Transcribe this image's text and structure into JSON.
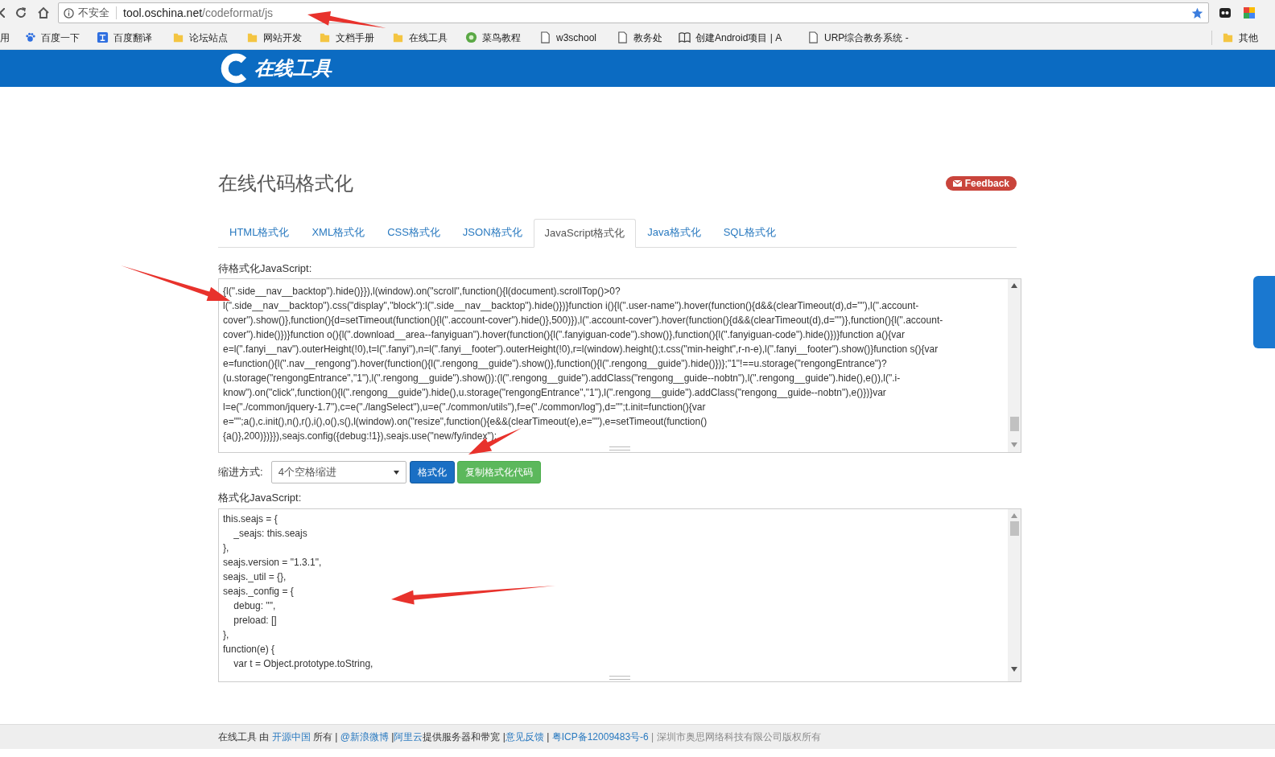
{
  "browser": {
    "security": "不安全",
    "url_host": "tool.oschina.net",
    "url_path": "/codeformat/js",
    "bookmarks": [
      {
        "label": "用",
        "kind": "none"
      },
      {
        "label": "百度一下",
        "kind": "paw"
      },
      {
        "label": "百度翻译",
        "kind": "translate"
      },
      {
        "label": "论坛站点",
        "kind": "folder"
      },
      {
        "label": "网站开发",
        "kind": "folder"
      },
      {
        "label": "文档手册",
        "kind": "folder"
      },
      {
        "label": "在线工具",
        "kind": "folder"
      },
      {
        "label": "菜鸟教程",
        "kind": "circle"
      },
      {
        "label": "w3school",
        "kind": "page"
      },
      {
        "label": "教务处",
        "kind": "page"
      },
      {
        "label": "创建Android项目 | A",
        "kind": "book"
      },
      {
        "label": "URP综合教务系统 - ",
        "kind": "page"
      }
    ],
    "other_bookmarks": "其他"
  },
  "header": {
    "logo_text": "在线工具"
  },
  "title": "在线代码格式化",
  "feedback": "Feedback",
  "tabs": [
    {
      "label": "HTML格式化",
      "selected": false
    },
    {
      "label": "XML格式化",
      "selected": false
    },
    {
      "label": "CSS格式化",
      "selected": false
    },
    {
      "label": "JSON格式化",
      "selected": false
    },
    {
      "label": "JavaScript格式化",
      "selected": true
    },
    {
      "label": "Java格式化",
      "selected": false
    },
    {
      "label": "SQL格式化",
      "selected": false
    }
  ],
  "input_label": "待格式化JavaScript:",
  "input_lines": [
    "{l(\".side__nav__backtop\").hide()}}),l(window).on(\"scroll\",function(){l(document).scrollTop()>0?",
    "l(\".side__nav__backtop\").css(\"display\",\"block\"):l(\".side__nav__backtop\").hide()})}function i(){l(\".user-name\").hover(function(){d&&(clearTimeout(d),d=\"\"),l(\".account-",
    "cover\").show()},function(){d=setTimeout(function(){l(\".account-cover\").hide()},500)}),l(\".account-cover\").hover(function(){d&&(clearTimeout(d),d=\"\")},function(){l(\".account-",
    "cover\").hide()})}function o(){l(\".download__area--fanyiguan\").hover(function(){l(\".fanyiguan-code\").show()},function(){l(\".fanyiguan-code\").hide()})}function a(){var",
    "e=l(\".fanyi__nav\").outerHeight(!0),t=l(\".fanyi\"),n=l(\".fanyi__footer\").outerHeight(!0),r=l(window).height();t.css(\"min-height\",r-n-e),l(\".fanyi__footer\").show()}function s(){var",
    "e=function(){l(\".nav__rengong\").hover(function(){l(\".rengong__guide\").show()},function(){l(\".rengong__guide\").hide()})};\"1\"!==u.storage(\"rengongEntrance\")?",
    "(u.storage(\"rengongEntrance\",\"1\"),l(\".rengong__guide\").show()):(l(\".rengong__guide\").addClass(\"rengong__guide--nobtn\"),l(\".rengong__guide\").hide(),e()),l(\".i-",
    "know\").on(\"click\",function(){l(\".rengong__guide\").hide(),u.storage(\"rengongEntrance\",\"1\"),l(\".rengong__guide\").addClass(\"rengong__guide--nobtn\"),e()})}var",
    "l=e(\"./common/jquery-1.7\"),c=e(\"./langSelect\"),u=e(\"./common/utils\"),f=e(\"./common/log\"),d=\"\";t.init=function(){var",
    "e=\"\";a(),c.init(),n(),r(),i(),o(),s(),l(window).on(\"resize\",function(){e&&(clearTimeout(e),e=\"\"),e=setTimeout(function()",
    "{a()},200)})}}),seajs.config({debug:!1}),seajs.use(\"new/fy/index\");"
  ],
  "indent_label": "缩进方式:",
  "indent_value": "4个空格缩进",
  "buttons": [
    {
      "label": "格式化",
      "kind": "primary"
    },
    {
      "label": "复制格式化代码",
      "kind": "success"
    }
  ],
  "output_label": "格式化JavaScript:",
  "output_lines": [
    "this.seajs = {",
    "    _seajs: this.seajs",
    "},",
    "seajs.version = \"1.3.1\",",
    "seajs._util = {},",
    "seajs._config = {",
    "    debug: \"\",",
    "    preload: []",
    "},",
    "function(e) {",
    "    var t = Object.prototype.toString,"
  ],
  "footer": [
    {
      "text": "在线工具 由 ",
      "kind": "text"
    },
    {
      "text": "开源中国",
      "kind": "link"
    },
    {
      "text": " 所有 | ",
      "kind": "text"
    },
    {
      "text": "@新浪微博",
      "kind": "link"
    },
    {
      "text": " |",
      "kind": "text"
    },
    {
      "text": "阿里云",
      "kind": "link"
    },
    {
      "text": "提供服务器和带宽 |",
      "kind": "text"
    },
    {
      "text": "意见反馈",
      "kind": "link"
    },
    {
      "text": " | ",
      "kind": "text"
    },
    {
      "text": "粤ICP备12009483号-6",
      "kind": "link"
    },
    {
      "text": " | 深圳市奥思网络科技有限公司版权所有",
      "kind": "note"
    }
  ]
}
